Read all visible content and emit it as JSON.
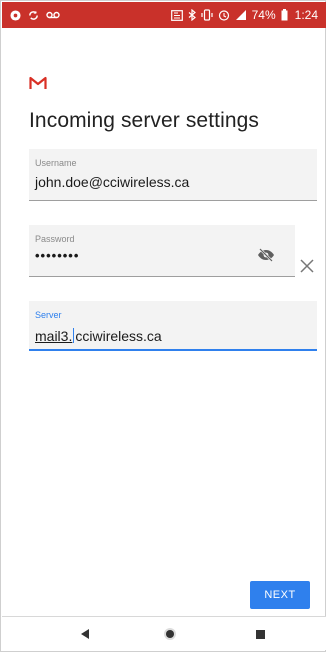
{
  "status_bar": {
    "battery": "74%",
    "time": "1:24",
    "icons": [
      "settings-gear-icon",
      "sync-icon",
      "voicemail-icon",
      "cast-icon",
      "bluetooth-icon",
      "vibrate-icon",
      "alarm-icon",
      "signal-icon",
      "battery-icon"
    ],
    "color": "#c9312a"
  },
  "header": {
    "logo": "gmail-logo-icon",
    "title": "Incoming server settings"
  },
  "form": {
    "username": {
      "label": "Username",
      "value": "john.doe@cciwireless.ca"
    },
    "password": {
      "label": "Password",
      "value": "••••••••"
    },
    "server": {
      "label": "Server",
      "value_selected": "mail3.",
      "value_rest": "cciwireless.ca"
    }
  },
  "actions": {
    "next_label": "NEXT",
    "accent": "#2f80ed"
  },
  "nav": {
    "icons": [
      "back-icon",
      "home-icon",
      "recent-apps-icon"
    ]
  }
}
